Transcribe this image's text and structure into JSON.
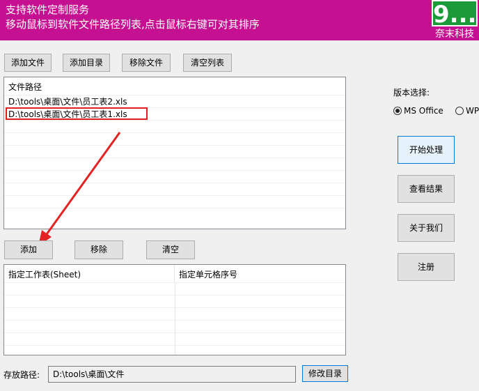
{
  "header": {
    "line1": "支持软件定制服务",
    "line2": "移动鼠标到软件文件路径列表,点击鼠标右键可对其排序",
    "logo_mark": "9...",
    "logo_text": "奈末科技"
  },
  "toolbar": {
    "add_file": "添加文件",
    "add_dir": "添加目录",
    "remove_file": "移除文件",
    "clear_list": "清空列表"
  },
  "file_list": {
    "header": "文件路径",
    "items": [
      "D:\\tools\\桌面\\文件\\员工表2.xls",
      "D:\\tools\\桌面\\文件\\员工表1.xls"
    ]
  },
  "sheet_buttons": {
    "add": "添加",
    "remove": "移除",
    "clear": "清空"
  },
  "sheet_table": {
    "columns": [
      "指定工作表(Sheet)",
      "指定单元格序号"
    ]
  },
  "version": {
    "label": "版本选择:",
    "options": [
      "MS Office",
      "WPS"
    ],
    "selected": "MS Office"
  },
  "side": {
    "start": "开始处理",
    "view": "查看结果",
    "about": "关于我们",
    "register": "注册"
  },
  "save": {
    "label": "存放路径:",
    "value": "D:\\tools\\桌面\\文件",
    "change": "修改目录"
  }
}
